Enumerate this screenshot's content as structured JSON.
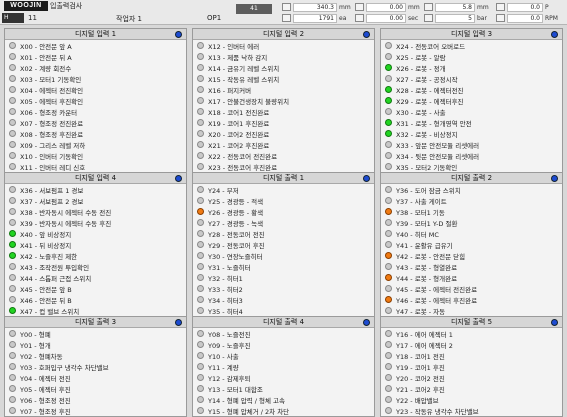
{
  "header": {
    "logo": "WOOJIN",
    "title": "입출력검사",
    "badge": "H",
    "badge_value": "11",
    "operator": "작업자 1",
    "op_code": "OP1",
    "count_top": "41",
    "meters": [
      {
        "value": "340.3",
        "unit": "mm"
      },
      {
        "value": "1791",
        "unit": "ea"
      },
      {
        "value": "0.00",
        "unit": "mm"
      },
      {
        "value": "0.00",
        "unit": "sec"
      },
      {
        "value": "5.8",
        "unit": "mm"
      },
      {
        "value": "5",
        "unit": "bar"
      },
      {
        "value": "0.0",
        "unit": "P"
      },
      {
        "value": "0.0",
        "unit": "RPM"
      }
    ]
  },
  "panels": [
    {
      "title": "디지털 입력 1",
      "rows": [
        {
          "label": "X00 - 안전문 앞 A",
          "led": "off"
        },
        {
          "label": "X01 - 안전문 뒤 A",
          "led": "off"
        },
        {
          "label": "X02 - 계량 회전수",
          "led": "off"
        },
        {
          "label": "X03 - 모터1 기동확인",
          "led": "off"
        },
        {
          "label": "X04 - 에젝터 전진확인",
          "led": "off"
        },
        {
          "label": "X05 - 에젝터 후진확인",
          "led": "off"
        },
        {
          "label": "X06 - 형조정 카운터",
          "led": "off"
        },
        {
          "label": "X07 - 형조정 전진완료",
          "led": "off"
        },
        {
          "label": "X08 - 형조정 후진완료",
          "led": "off"
        },
        {
          "label": "X09 - 그리스 레벨 저하",
          "led": "off"
        },
        {
          "label": "X10 - 인버터 기동확인",
          "led": "off"
        },
        {
          "label": "X11 - 인버터 레디 신호",
          "led": "off"
        }
      ]
    },
    {
      "title": "디지털 입력 2",
      "rows": [
        {
          "label": "X12 - 인버터 에러",
          "led": "off"
        },
        {
          "label": "X13 - 제품 낙하 감지",
          "led": "off"
        },
        {
          "label": "X14 - 금유기 레벨 스위치",
          "led": "off"
        },
        {
          "label": "X15 - 작동유 레벨 스위치",
          "led": "off"
        },
        {
          "label": "X16 - 퍼지커버",
          "led": "off"
        },
        {
          "label": "X17 - 안불건생장치 불량위치",
          "led": "off"
        },
        {
          "label": "X18 - 코어1 전진완료",
          "led": "off"
        },
        {
          "label": "X19 - 코어1 후진완료",
          "led": "off"
        },
        {
          "label": "X20 - 코어2 전진완료",
          "led": "off"
        },
        {
          "label": "X21 - 코어2 후진완료",
          "led": "off"
        },
        {
          "label": "X22 - 전동코어 전진완료",
          "led": "off"
        },
        {
          "label": "X23 - 전동코어 후진완료",
          "led": "off"
        }
      ]
    },
    {
      "title": "디지털 입력 3",
      "rows": [
        {
          "label": "X24 - 전동코어 오버로드",
          "led": "off"
        },
        {
          "label": "X25 - 로봇 - 알람",
          "led": "off"
        },
        {
          "label": "X26 - 로봇 - 정개",
          "led": "green"
        },
        {
          "label": "X27 - 로봇 - 공정시작",
          "led": "off"
        },
        {
          "label": "X28 - 로봇 - 에젝터전진",
          "led": "green"
        },
        {
          "label": "X29 - 로봇 - 에젝터후진",
          "led": "green"
        },
        {
          "label": "X30 - 로봇 - 사출",
          "led": "off"
        },
        {
          "label": "X31 - 로봇 - 형개영역 안전",
          "led": "green"
        },
        {
          "label": "X32 - 로봇 - 비상정지",
          "led": "green"
        },
        {
          "label": "X33 - 앞문 안전모듈 리셋에러",
          "led": "off"
        },
        {
          "label": "X34 - 뒷문 안전모듈 리셋에러",
          "led": "off"
        },
        {
          "label": "X35 - 모터2 기동확인",
          "led": "off"
        }
      ]
    },
    {
      "title": "디지털 입력 4",
      "rows": [
        {
          "label": "X36 - 서보펌프 1 경보",
          "led": "off"
        },
        {
          "label": "X37 - 서보펌프 2 경보",
          "led": "off"
        },
        {
          "label": "X38 - 반자동시 에젝터 수동 전진",
          "led": "off"
        },
        {
          "label": "X39 - 반자동시 에젝터 수동 후진",
          "led": "off"
        },
        {
          "label": "X40 - 앞 비상정지",
          "led": "green"
        },
        {
          "label": "X41 - 뒤 비상정지",
          "led": "green"
        },
        {
          "label": "X42 - 노즐후진 제한",
          "led": "green"
        },
        {
          "label": "X43 - 조작전원 투입확인",
          "led": "off"
        },
        {
          "label": "X44 - 스톱퍼 근접 스위치",
          "led": "off"
        },
        {
          "label": "X45 - 안전문 앞 B",
          "led": "off"
        },
        {
          "label": "X46 - 안전문 뒤 B",
          "led": "off"
        },
        {
          "label": "X47 - 컵 밸브 스위치",
          "led": "green"
        }
      ]
    },
    {
      "title": "디지털 출력 1",
      "rows": [
        {
          "label": "Y24 - 부저",
          "led": "off"
        },
        {
          "label": "Y25 - 경광등 - 적색",
          "led": "off"
        },
        {
          "label": "Y26 - 경광등 - 황색",
          "led": "orange"
        },
        {
          "label": "Y27 - 경광등 - 녹색",
          "led": "off"
        },
        {
          "label": "Y28 - 전동코어 전진",
          "led": "off"
        },
        {
          "label": "Y29 - 전동코어 후진",
          "led": "off"
        },
        {
          "label": "Y30 - 연장노즐히터",
          "led": "off"
        },
        {
          "label": "Y31 - 노즐히터",
          "led": "off"
        },
        {
          "label": "Y32 - 히터1",
          "led": "off"
        },
        {
          "label": "Y33 - 히터2",
          "led": "off"
        },
        {
          "label": "Y34 - 히터3",
          "led": "off"
        },
        {
          "label": "Y35 - 히터4",
          "led": "off"
        }
      ]
    },
    {
      "title": "디지털 출력 2",
      "rows": [
        {
          "label": "Y36 - 도어 잠금 스위치",
          "led": "off"
        },
        {
          "label": "Y37 - 사출 게이트",
          "led": "off"
        },
        {
          "label": "Y38 - 모터1 기동",
          "led": "orange"
        },
        {
          "label": "Y39 - 모터1 Y-D 절환",
          "led": "off"
        },
        {
          "label": "Y40 - 히터 MC",
          "led": "off"
        },
        {
          "label": "Y41 - 윤활유 급유기",
          "led": "off"
        },
        {
          "label": "Y42 - 로봇 - 안전문 닫힘",
          "led": "orange"
        },
        {
          "label": "Y43 - 로봇 - 형열완료",
          "led": "off"
        },
        {
          "label": "Y44 - 로봇 - 형개완료",
          "led": "orange"
        },
        {
          "label": "Y45 - 로봇 - 에젝터 전진완료",
          "led": "off"
        },
        {
          "label": "Y46 - 로봇 - 에젝터 후진완료",
          "led": "orange"
        },
        {
          "label": "Y47 - 로봇 - 자동",
          "led": "off"
        }
      ]
    },
    {
      "title": "디지털 출력 3",
      "rows": [
        {
          "label": "Y00 - 형폐",
          "led": "off"
        },
        {
          "label": "Y01 - 형개",
          "led": "off"
        },
        {
          "label": "Y02 - 형폐차동",
          "led": "off"
        },
        {
          "label": "Y03 - 호퍼입구 냉각수 차단밸브",
          "led": "off"
        },
        {
          "label": "Y04 - 에젝터 전진",
          "led": "off"
        },
        {
          "label": "Y05 - 에젝터 후진",
          "led": "off"
        },
        {
          "label": "Y06 - 형조정 전진",
          "led": "off"
        },
        {
          "label": "Y07 - 형조정 후진",
          "led": "off"
        }
      ]
    },
    {
      "title": "디지털 출력 4",
      "rows": [
        {
          "label": "Y08 - 노즐전진",
          "led": "off"
        },
        {
          "label": "Y09 - 노즐후진",
          "led": "off"
        },
        {
          "label": "Y10 - 사출",
          "led": "off"
        },
        {
          "label": "Y11 - 계량",
          "led": "off"
        },
        {
          "label": "Y12 - 감제후퇴",
          "led": "off"
        },
        {
          "label": "Y13 - 모터1 대합조",
          "led": "off"
        },
        {
          "label": "Y14 - 형폐 압력 / 형체 고속",
          "led": "off"
        },
        {
          "label": "Y15 - 형폐 압체거 / 2차 차단",
          "led": "off"
        }
      ]
    },
    {
      "title": "디지털 출력 5",
      "rows": [
        {
          "label": "Y16 - 에어 에젝터 1",
          "led": "off"
        },
        {
          "label": "Y17 - 에어 에젝터 2",
          "led": "off"
        },
        {
          "label": "Y18 - 코어1 전진",
          "led": "off"
        },
        {
          "label": "Y19 - 코어1 후진",
          "led": "off"
        },
        {
          "label": "Y20 - 코어2 전진",
          "led": "off"
        },
        {
          "label": "Y21 - 코어2 후진",
          "led": "off"
        },
        {
          "label": "Y22 - 배압밸브",
          "led": "off"
        },
        {
          "label": "Y23 - 작동유 냉각수 차단밸브",
          "led": "off"
        }
      ]
    }
  ]
}
